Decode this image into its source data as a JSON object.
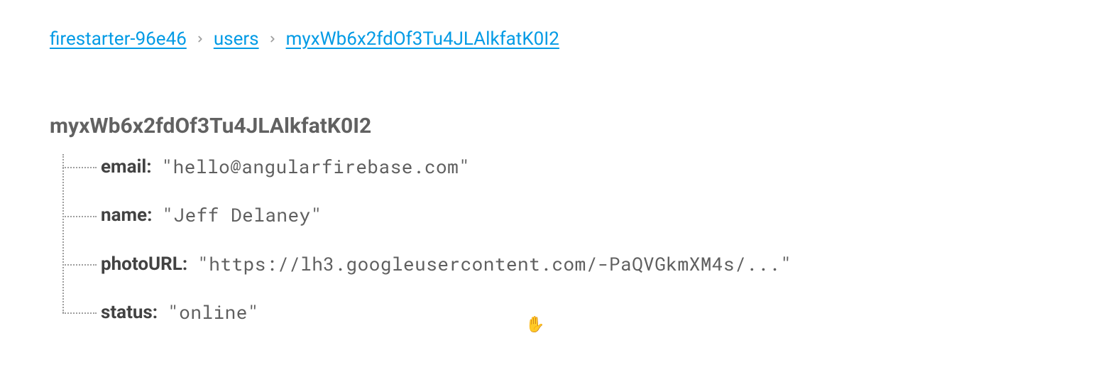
{
  "breadcrumb": {
    "items": [
      {
        "label": "firestarter-96e46"
      },
      {
        "label": "users"
      },
      {
        "label": "myxWb6x2fdOf3Tu4JLAlkfatK0I2"
      }
    ]
  },
  "document": {
    "id": "myxWb6x2fdOf3Tu4JLAlkfatK0I2",
    "fields": [
      {
        "key": "email",
        "value": "\"hello@angularfirebase.com\""
      },
      {
        "key": "name",
        "value": "\"Jeff Delaney\""
      },
      {
        "key": "photoURL",
        "value": "\"https://lh3.googleusercontent.com/-PaQVGkmXM4s/...\""
      },
      {
        "key": "status",
        "value": "\"online\""
      }
    ]
  }
}
